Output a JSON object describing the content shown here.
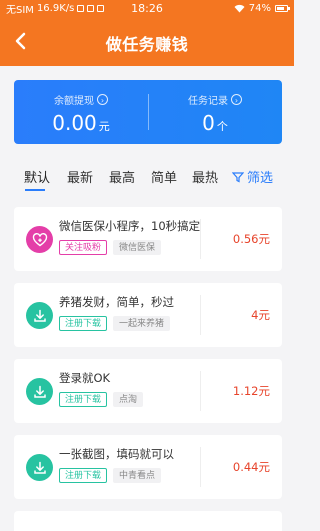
{
  "status_bar": {
    "carrier": "无SIM",
    "speed": "16.9K/s",
    "time": "18:26",
    "battery": "74%"
  },
  "header": {
    "title": "做任务赚钱"
  },
  "balance": {
    "withdraw_label": "余额提现",
    "withdraw_value": "0.00",
    "withdraw_unit": "元",
    "records_label": "任务记录",
    "records_value": "0",
    "records_unit": "个"
  },
  "tabs": [
    {
      "label": "默认",
      "active": true
    },
    {
      "label": "最新",
      "active": false
    },
    {
      "label": "最高",
      "active": false
    },
    {
      "label": "简单",
      "active": false
    },
    {
      "label": "最热",
      "active": false
    }
  ],
  "filter_label": "筛选",
  "tasks": [
    {
      "name": "微信医保小程序，10秒搞定",
      "tags": [
        {
          "text": "关注吸粉",
          "style": "pink"
        },
        {
          "text": "微信医保",
          "style": "gray"
        }
      ],
      "price": "0.56元",
      "icon": "heart-plus-icon",
      "icon_color": "#e43ea8"
    },
    {
      "name": "养猪发财，简单，秒过",
      "tags": [
        {
          "text": "注册下载",
          "style": "green"
        },
        {
          "text": "一起来养猪",
          "style": "gray"
        }
      ],
      "price": "4元",
      "icon": "download-icon",
      "icon_color": "#27c3a1"
    },
    {
      "name": "登录就OK",
      "tags": [
        {
          "text": "注册下载",
          "style": "green"
        },
        {
          "text": "点淘",
          "style": "gray"
        }
      ],
      "price": "1.12元",
      "icon": "download-icon",
      "icon_color": "#27c3a1"
    },
    {
      "name": "一张截图，填码就可以",
      "tags": [
        {
          "text": "注册下载",
          "style": "green"
        },
        {
          "text": "中青看点",
          "style": "gray"
        }
      ],
      "price": "0.44元",
      "icon": "download-icon",
      "icon_color": "#27c3a1"
    }
  ],
  "colors": {
    "header": "#f47621",
    "accent_blue": "#2a7dfb",
    "price_red": "#e7442b",
    "tag_green": "#27c3a1",
    "tag_pink": "#e43ea8"
  }
}
